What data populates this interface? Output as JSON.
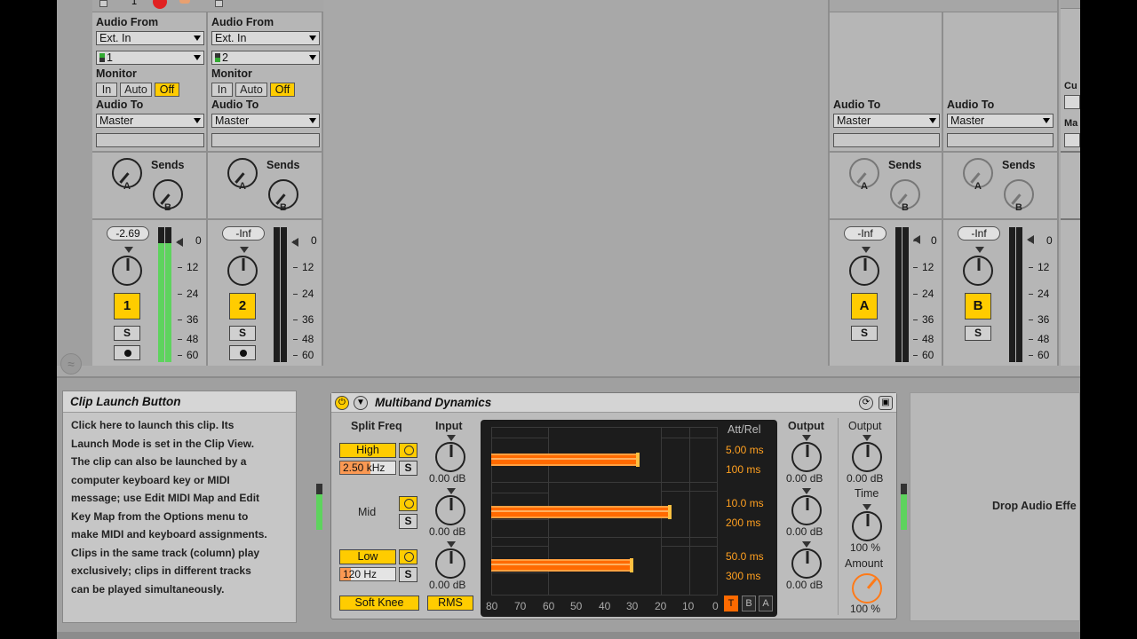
{
  "tracks": [
    {
      "id": "track-1",
      "audio_from_label": "Audio From",
      "audio_from": "Ext. In",
      "channel": "1",
      "monitor_label": "Monitor",
      "monitor_options": [
        "In",
        "Auto",
        "Off"
      ],
      "audio_to_label": "Audio To",
      "audio_to": "Master",
      "sends_label": "Sends",
      "send_a": "A",
      "send_b": "B",
      "volume": "-2.69",
      "number": "1",
      "solo": "S",
      "meter_level": 0.88
    },
    {
      "id": "track-2",
      "audio_from_label": "Audio From",
      "audio_from": "Ext. In",
      "channel": "2",
      "monitor_label": "Monitor",
      "monitor_options": [
        "In",
        "Auto",
        "Off"
      ],
      "audio_to_label": "Audio To",
      "audio_to": "Master",
      "sends_label": "Sends",
      "send_a": "A",
      "send_b": "B",
      "volume": "-Inf",
      "number": "2",
      "solo": "S",
      "meter_level": 0
    },
    {
      "id": "return-a",
      "audio_to_label": "Audio To",
      "audio_to": "Master",
      "sends_label": "Sends",
      "send_a": "A",
      "send_b": "B",
      "volume": "-Inf",
      "number": "A",
      "solo": "S",
      "meter_level": 0
    },
    {
      "id": "return-b",
      "audio_to_label": "Audio To",
      "audio_to": "Master",
      "sends_label": "Sends",
      "send_a": "A",
      "send_b": "B",
      "volume": "-Inf",
      "number": "B",
      "solo": "S",
      "meter_level": 0
    }
  ],
  "master_partial": {
    "cue_label": "Cu",
    "master_label": "Ma"
  },
  "meter_scale": [
    "0",
    "12",
    "24",
    "36",
    "48",
    "60"
  ],
  "info": {
    "title": "Clip Launch Button",
    "lines": [
      "Click here to launch this clip. Its",
      "Launch Mode is set in the Clip View.",
      "The clip can also be launched by a",
      "computer keyboard key or MIDI",
      "message; use Edit MIDI Map and Edit",
      "Key Map from the Options menu to",
      "make MIDI and keyboard assignments.",
      "Clips in the same track (column) play",
      "exclusively; clips in different tracks",
      "can be played simultaneously."
    ]
  },
  "device": {
    "title": "Multiband Dynamics",
    "split_freq_label": "Split Freq",
    "input_label": "Input",
    "output_label": "Output",
    "output2_label": "Output",
    "time_label": "Time",
    "amount_label": "Amount",
    "att_rel_label": "Att/Rel",
    "high_label": "High",
    "mid_label": "Mid",
    "low_label": "Low",
    "high_freq": "2.50 kHz",
    "high_freq_fill": 0.55,
    "low_freq": "120 Hz",
    "low_freq_fill": 0.2,
    "solo_label": "S",
    "input_gains": [
      "0.00 dB",
      "0.00 dB",
      "0.00 dB"
    ],
    "output_gains": [
      "0.00 dB",
      "0.00 dB",
      "0.00 dB"
    ],
    "master_output": "0.00 dB",
    "time": "100 %",
    "amount": "100 %",
    "soft_knee": "Soft Knee",
    "rms": "RMS",
    "bands": [
      {
        "attack": "5.00 ms",
        "release": "100 ms",
        "level": 0.64
      },
      {
        "attack": "10.0 ms",
        "release": "200 ms",
        "level": 0.78
      },
      {
        "attack": "50.0 ms",
        "release": "300 ms",
        "level": 0.61
      }
    ],
    "x_axis": [
      "80",
      "70",
      "60",
      "50",
      "40",
      "30",
      "20",
      "10",
      "0"
    ],
    "mode_buttons": [
      "T",
      "B",
      "A"
    ]
  },
  "drop_text": "Drop Audio Effe"
}
